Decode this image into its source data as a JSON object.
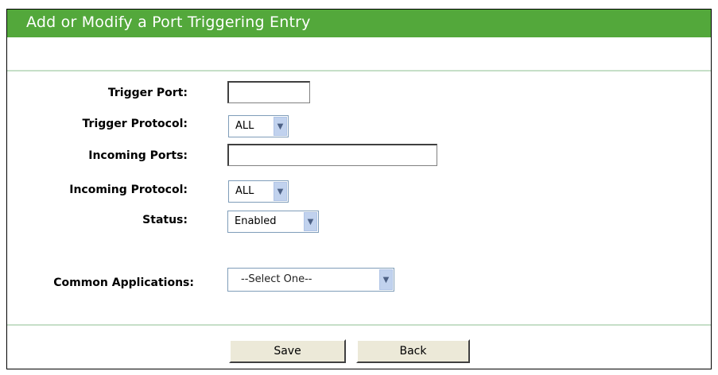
{
  "header": {
    "title": "Add or Modify a Port Triggering Entry"
  },
  "form": {
    "trigger_port": {
      "label": "Trigger Port:",
      "value": ""
    },
    "trigger_protocol": {
      "label": "Trigger Protocol:",
      "value": "ALL"
    },
    "incoming_ports": {
      "label": "Incoming Ports:",
      "value": ""
    },
    "incoming_protocol": {
      "label": "Incoming Protocol:",
      "value": "ALL"
    },
    "status": {
      "label": "Status:",
      "value": "Enabled"
    },
    "common_applications": {
      "label": "Common Applications:",
      "value": "--Select One--"
    }
  },
  "buttons": {
    "save": "Save",
    "back": "Back"
  },
  "colors": {
    "header_bg": "#53a83b",
    "divider": "#c6dfc8"
  },
  "icons": {
    "dropdown": "chevron-down-icon"
  }
}
